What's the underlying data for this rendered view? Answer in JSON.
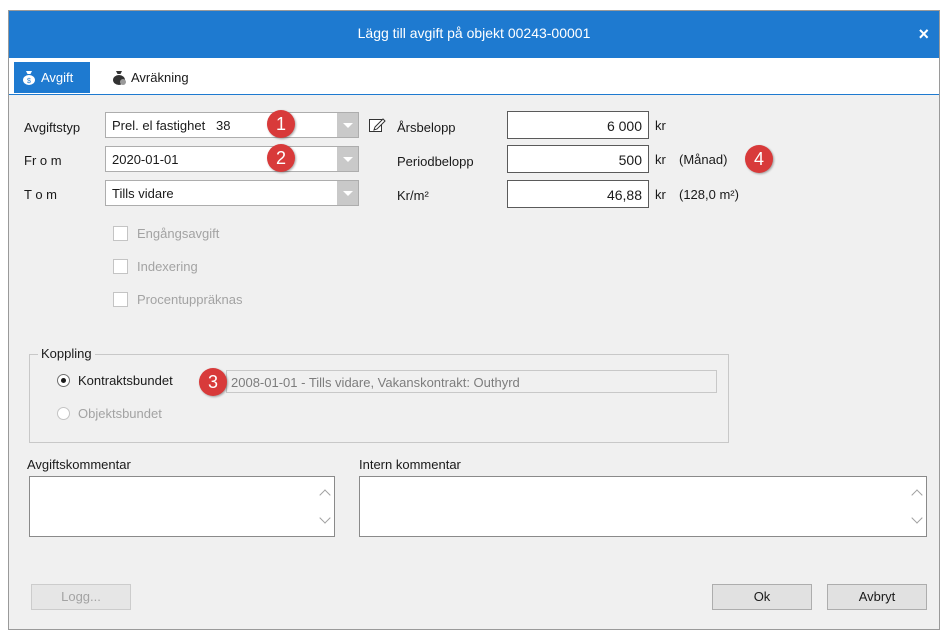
{
  "window": {
    "title": "Lägg till avgift på objekt 00243-00001",
    "close_label": "×"
  },
  "tabs": [
    {
      "label": "Avgift",
      "icon": "moneybag-icon",
      "active": true
    },
    {
      "label": "Avräkning",
      "icon": "moneybag-settle-icon",
      "active": false
    }
  ],
  "form": {
    "avgiftstyp": {
      "label": "Avgiftstyp",
      "value": "Prel. el fastighet   38"
    },
    "from": {
      "label": "Fr o m",
      "value": "2020-01-01"
    },
    "tom": {
      "label": "T o m",
      "value": "Tills vidare"
    },
    "checkboxes": [
      {
        "label": "Engångsavgift",
        "checked": false,
        "disabled": true
      },
      {
        "label": "Indexering",
        "checked": false,
        "disabled": true
      },
      {
        "label": "Procentuppräknas",
        "checked": false,
        "disabled": true
      }
    ],
    "arsbelopp": {
      "label": "Årsbelopp",
      "value": "6 000",
      "unit": "kr"
    },
    "periodbelopp": {
      "label": "Periodbelopp",
      "value": "500",
      "unit": "kr",
      "suffix": "(Månad)"
    },
    "kr_m2": {
      "label": "Kr/m²",
      "value": "46,88",
      "unit": "kr",
      "suffix": "(128,0 m²)"
    }
  },
  "koppling": {
    "legend": "Koppling",
    "kontraktsbundet": {
      "label": "Kontraktsbundet",
      "checked": true
    },
    "kontrakt_text": "2008-01-01 - Tills vidare, Vakanskontrakt: Outhyrd",
    "objektsbundet": {
      "label": "Objektsbundet",
      "checked": false,
      "disabled": true
    }
  },
  "comments": {
    "avgiftskommentar_label": "Avgiftskommentar",
    "intern_kommentar_label": "Intern kommentar"
  },
  "buttons": {
    "logg": "Logg...",
    "ok": "Ok",
    "avbryt": "Avbryt"
  },
  "annotations": [
    "1",
    "2",
    "3",
    "4"
  ],
  "colors": {
    "titlebar": "#1e7ad0",
    "badge": "#d83a3a",
    "dialog_bg": "#f0f0f0"
  }
}
